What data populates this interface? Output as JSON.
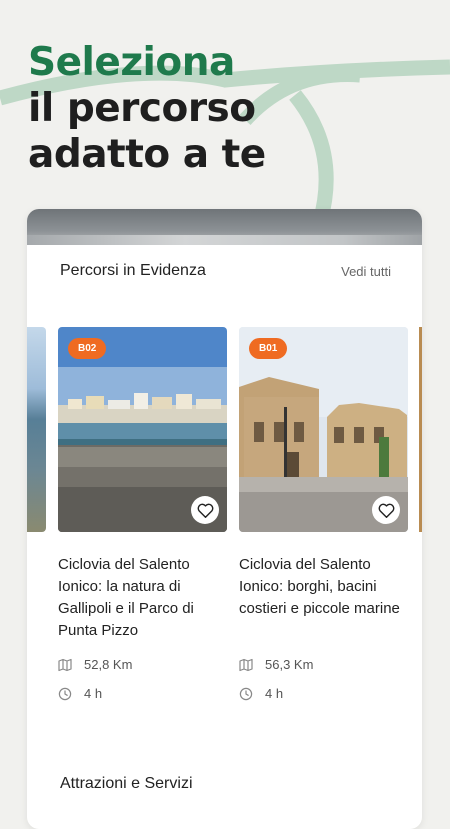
{
  "headline": {
    "line1": "Seleziona",
    "line2": "il percorso",
    "line3": "adatto a te"
  },
  "colors": {
    "accent_green": "#1f7a4c",
    "badge_orange": "#ef6b22",
    "background": "#f1f1ee"
  },
  "featured": {
    "title": "Percorsi in Evidenza",
    "see_all": "Vedi tutti",
    "routes": [
      {
        "badge": "B02",
        "title": "Ciclovia del Salento Ionico: la natura di Gallipoli e il Parco di Punta Pizzo",
        "distance": "52,8 Km",
        "duration": "4 h",
        "favorite_icon": "heart-outline-icon"
      },
      {
        "badge": "B01",
        "title": "Ciclovia del Salento Ionico: borghi, bacini costieri e piccole marine",
        "distance": "56,3 Km",
        "duration": "4 h",
        "favorite_icon": "heart-outline-icon"
      }
    ]
  },
  "services": {
    "title": "Attrazioni e Servizi"
  }
}
